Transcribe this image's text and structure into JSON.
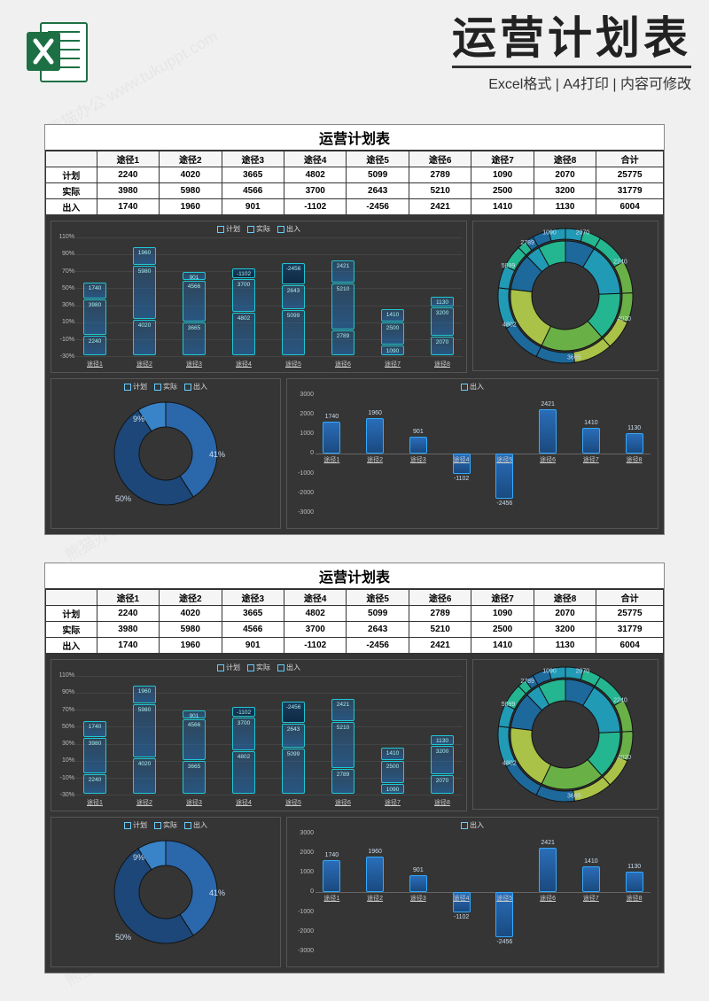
{
  "page": {
    "title": "运营计划表",
    "subtitle": "Excel格式 | A4打印 | 内容可修改",
    "watermark": "熊猫办公 www.tukuppt.com"
  },
  "table": {
    "title": "运营计划表",
    "col_labels": [
      "",
      "途径1",
      "途径2",
      "途径3",
      "途径4",
      "途径5",
      "途径6",
      "途径7",
      "途径8",
      "合计"
    ],
    "rows": [
      {
        "label": "计划",
        "vals": [
          2240,
          4020,
          3665,
          4802,
          5099,
          2789,
          1090,
          2070,
          25775
        ]
      },
      {
        "label": "实际",
        "vals": [
          3980,
          5980,
          4566,
          3700,
          2643,
          5210,
          2500,
          3200,
          31779
        ]
      },
      {
        "label": "出入",
        "vals": [
          1740,
          1960,
          901,
          -1102,
          -2456,
          2421,
          1410,
          1130,
          6004
        ]
      }
    ]
  },
  "chart_data": [
    {
      "id": "stacked_pct",
      "type": "bar",
      "title": "",
      "series_names": [
        "计划",
        "实际",
        "出入"
      ],
      "categories": [
        "途径1",
        "途径2",
        "途径3",
        "途径4",
        "途径5",
        "途径6",
        "途径7",
        "途径8"
      ],
      "series": [
        {
          "name": "计划",
          "values": [
            2240,
            4020,
            3665,
            4802,
            5099,
            2789,
            1090,
            2070
          ]
        },
        {
          "name": "实际",
          "values": [
            3980,
            5980,
            4566,
            3700,
            2643,
            5210,
            2500,
            3200
          ]
        },
        {
          "name": "出入",
          "values": [
            1740,
            1960,
            901,
            -1102,
            -2456,
            2421,
            1410,
            1130
          ]
        }
      ],
      "yticks": [
        "110%",
        "90%",
        "70%",
        "50%",
        "30%",
        "10%",
        "-10%",
        "-30%"
      ],
      "ylim": [
        -30,
        110
      ]
    },
    {
      "id": "sunburst",
      "type": "pie",
      "title": "",
      "inner": {
        "categories": [
          "途径1",
          "途径2",
          "途径3",
          "途径4",
          "途径5",
          "途径6",
          "途径7",
          "途径8"
        ],
        "values": [
          2240,
          4020,
          3665,
          4802,
          5099,
          2789,
          1090,
          2070
        ]
      },
      "outer_labels": [
        2070,
        2240,
        4020,
        3665,
        4802,
        5099,
        2789,
        1090
      ]
    },
    {
      "id": "donut_summary",
      "type": "pie",
      "series_names": [
        "计划",
        "实际",
        "出入"
      ],
      "values": [
        41,
        50,
        9
      ],
      "labels": [
        "41%",
        "50%",
        "9%"
      ]
    },
    {
      "id": "diff_bar",
      "type": "bar",
      "series_names": [
        "出入"
      ],
      "categories": [
        "途径1",
        "途径2",
        "途径3",
        "途径4",
        "途径5",
        "途径6",
        "途径7",
        "途径8"
      ],
      "values": [
        1740,
        1960,
        901,
        -1102,
        -2456,
        2421,
        1410,
        1130
      ],
      "ylim": [
        -3000,
        3000
      ],
      "yticks": [
        "3000",
        "2000",
        "1000",
        "0",
        "-1000",
        "-2000",
        "-3000"
      ]
    }
  ],
  "colors": {
    "excel_green": "#1d7044",
    "dark_bg": "#353535",
    "accent": "#1fc7d4",
    "bar": "#2a6db8"
  }
}
